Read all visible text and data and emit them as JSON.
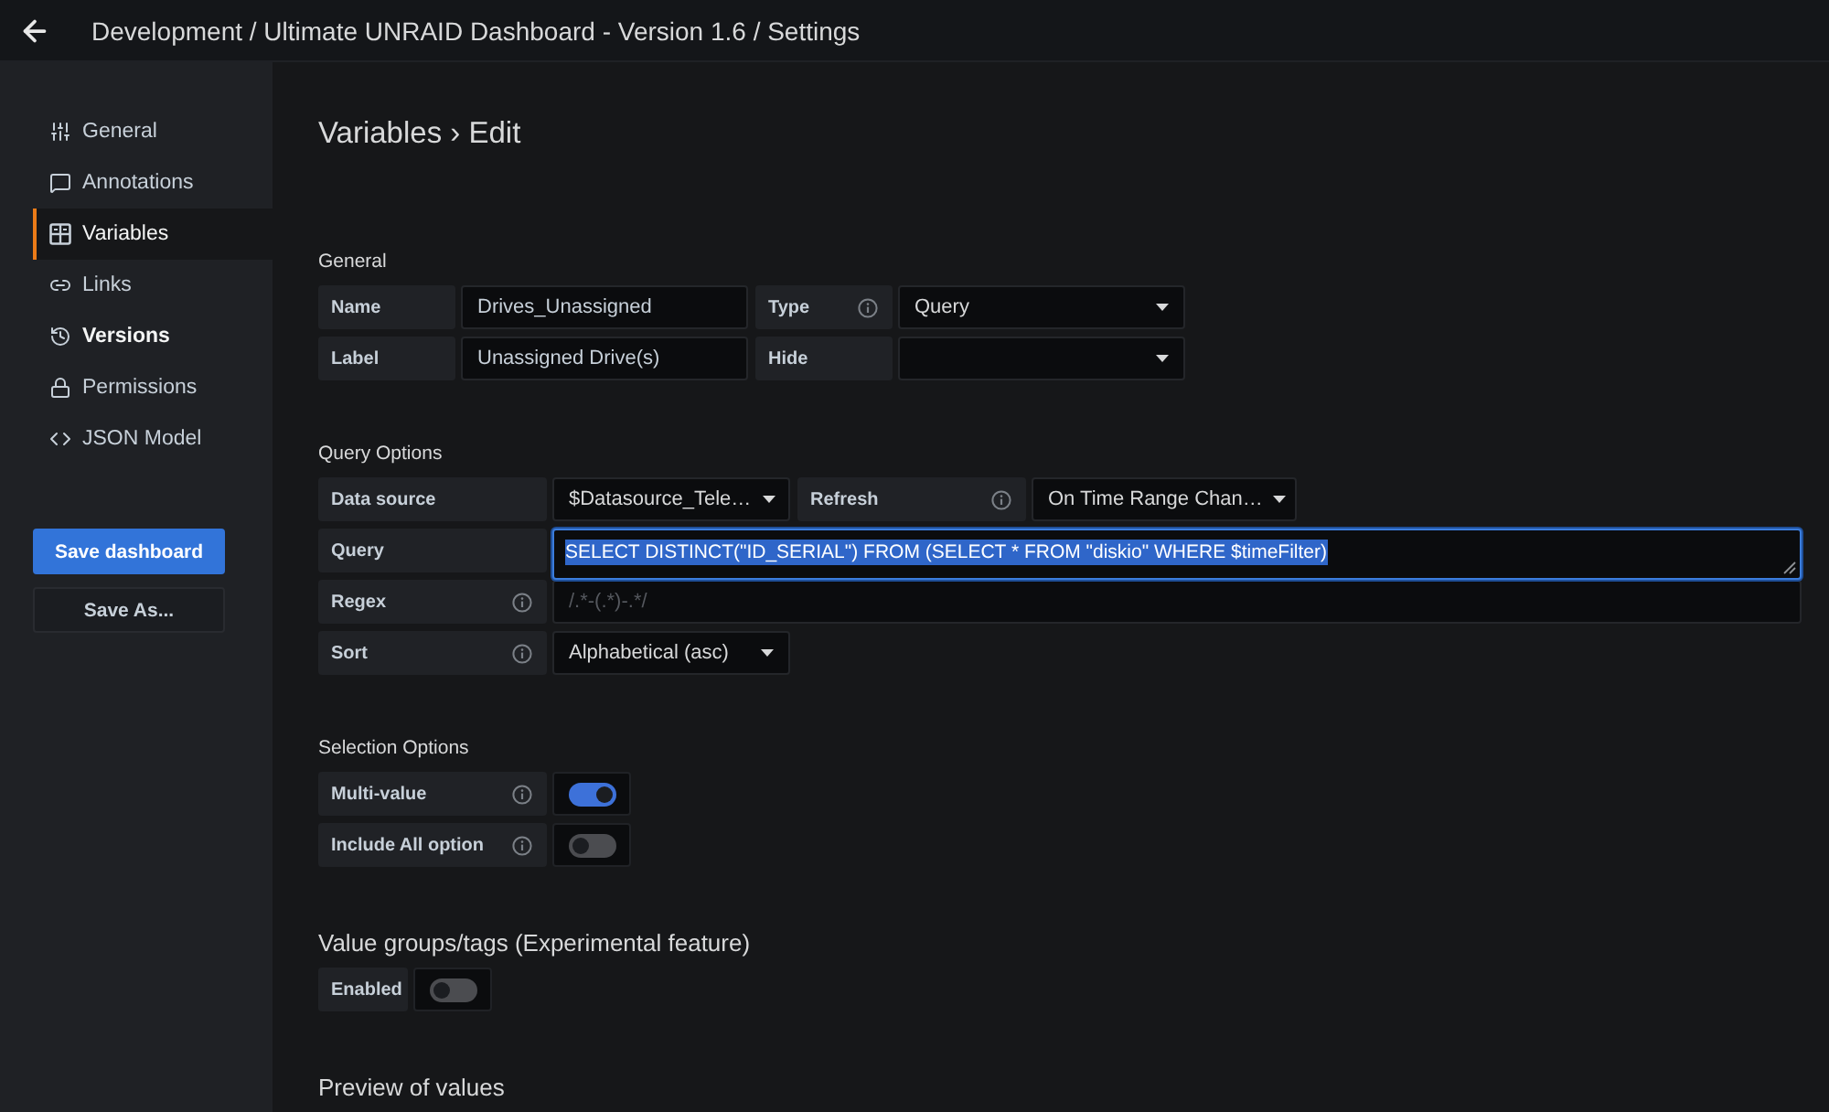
{
  "header": {
    "title": "Development / Ultimate UNRAID Dashboard - Version 1.6 / Settings"
  },
  "sidebar": {
    "items": [
      {
        "label": "General",
        "selected": false,
        "hovered": false
      },
      {
        "label": "Annotations",
        "selected": false,
        "hovered": false
      },
      {
        "label": "Variables",
        "selected": true,
        "hovered": false
      },
      {
        "label": "Links",
        "selected": false,
        "hovered": false
      },
      {
        "label": "Versions",
        "selected": false,
        "hovered": true
      },
      {
        "label": "Permissions",
        "selected": false,
        "hovered": false
      },
      {
        "label": "JSON Model",
        "selected": false,
        "hovered": false
      }
    ],
    "buttons": [
      {
        "label": "Save dashboard",
        "kind": "primary"
      },
      {
        "label": "Save As...",
        "kind": "secondary"
      }
    ]
  },
  "page_title": "Variables › Edit",
  "sections": [
    {
      "heading": "General",
      "kind": "minor",
      "rows": [
        [
          {
            "label": "Name",
            "info": false,
            "control": {
              "kind": "input",
              "value": "Drives_Unassigned"
            }
          },
          {
            "label": "Type",
            "info": true,
            "control": {
              "kind": "select",
              "value": "Query"
            }
          }
        ],
        [
          {
            "label": "Label",
            "info": false,
            "control": {
              "kind": "input",
              "value": "Unassigned Drive(s)"
            }
          },
          {
            "label": "Hide",
            "info": false,
            "control": {
              "kind": "select"
            }
          }
        ]
      ]
    },
    {
      "heading": "Query Options",
      "kind": "minor",
      "rows": [
        [
          {
            "label": "Data source",
            "info": false,
            "control": {
              "kind": "select",
              "value": "$Datasource_Tele…"
            }
          },
          {
            "label": "Refresh",
            "info": true,
            "control": {
              "kind": "select",
              "value": "On Time Range Chan…"
            }
          }
        ],
        [
          {
            "label": "Query",
            "info": false,
            "control": {
              "kind": "textarea",
              "value": "SELECT DISTINCT(\"ID_SERIAL\") FROM (SELECT * FROM \"diskio\" WHERE $timeFilter)",
              "focused": true,
              "text_selected": true
            }
          }
        ],
        [
          {
            "label": "Regex",
            "info": true,
            "control": {
              "kind": "input",
              "placeholder": "/.*-(.*)-.*/"
            }
          }
        ],
        [
          {
            "label": "Sort",
            "info": true,
            "control": {
              "kind": "select",
              "value": "Alphabetical (asc)"
            }
          }
        ]
      ]
    },
    {
      "heading": "Selection Options",
      "kind": "minor",
      "rows": [
        [
          {
            "label": "Multi-value",
            "info": true,
            "control": {
              "kind": "switch",
              "on": true
            }
          }
        ],
        [
          {
            "label": "Include All option",
            "info": true,
            "control": {
              "kind": "switch",
              "on": false
            }
          }
        ]
      ]
    },
    {
      "heading": "Value groups/tags (Experimental feature)",
      "kind": "major",
      "rows": [
        [
          {
            "label": "Enabled",
            "info": false,
            "control": {
              "kind": "switch",
              "on": false
            }
          }
        ]
      ]
    },
    {
      "heading": "Preview of values",
      "kind": "major"
    }
  ]
}
